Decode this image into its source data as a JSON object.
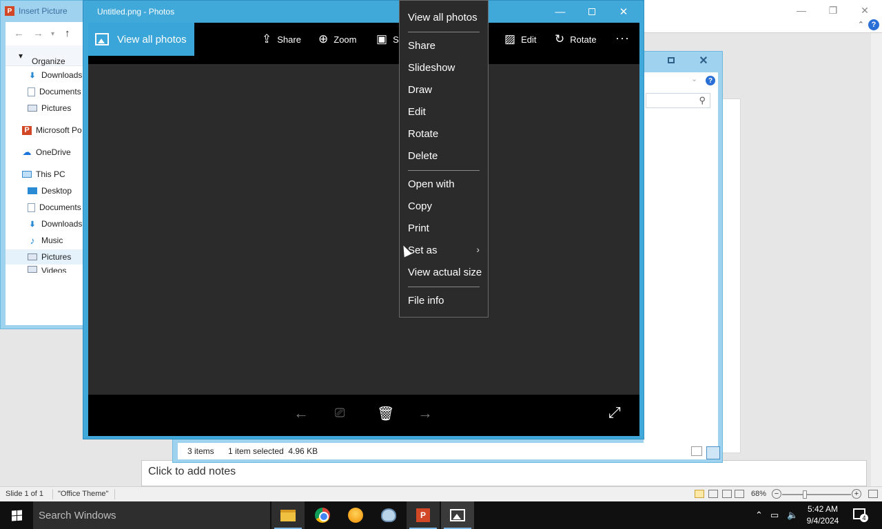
{
  "powerpoint": {
    "notes_placeholder": "Click to add notes",
    "status": {
      "slide": "Slide 1 of 1",
      "theme": "\"Office Theme\"",
      "zoom": "68%"
    }
  },
  "insert_picture": {
    "title": "Insert Picture",
    "organize": "Organize",
    "tree": [
      {
        "label": "Downloads",
        "icon": "download-icon"
      },
      {
        "label": "Documents",
        "icon": "document-icon"
      },
      {
        "label": "Pictures",
        "icon": "pictures-icon"
      },
      {
        "label": "Microsoft Po",
        "icon": "powerpoint-icon"
      },
      {
        "label": "OneDrive",
        "icon": "onedrive-icon"
      },
      {
        "label": "This PC",
        "icon": "computer-icon"
      },
      {
        "label": "Desktop",
        "icon": "desktop-icon"
      },
      {
        "label": "Documents",
        "icon": "document-icon"
      },
      {
        "label": "Downloads",
        "icon": "download-icon"
      },
      {
        "label": "Music",
        "icon": "music-icon"
      },
      {
        "label": "Pictures",
        "icon": "pictures-icon"
      },
      {
        "label": "Videos",
        "icon": "video-icon"
      }
    ]
  },
  "file_dialog": {
    "items_count": "3 items",
    "selection": "1 item selected  4.96 KB"
  },
  "photos": {
    "title": "Untitled.png - Photos",
    "view_all": "View all photos",
    "toolbar": {
      "share": "Share",
      "zoom": "Zoom",
      "slideshow_partial": "S",
      "edit": "Edit",
      "rotate": "Rotate"
    }
  },
  "context_menu": {
    "items": [
      "View all photos",
      "Share",
      "Slideshow",
      "Draw",
      "Edit",
      "Rotate",
      "Delete",
      "Open with",
      "Copy",
      "Print",
      "Set as",
      "View actual size",
      "File info"
    ]
  },
  "taskbar": {
    "search_placeholder": "Search Windows",
    "time": "5:42 AM",
    "date": "9/4/2024",
    "notifications": "4"
  },
  "colors": {
    "photos_accent": "#41a9d9",
    "menu_bg": "#2b2b2b",
    "taskbar_bg": "#101010"
  }
}
